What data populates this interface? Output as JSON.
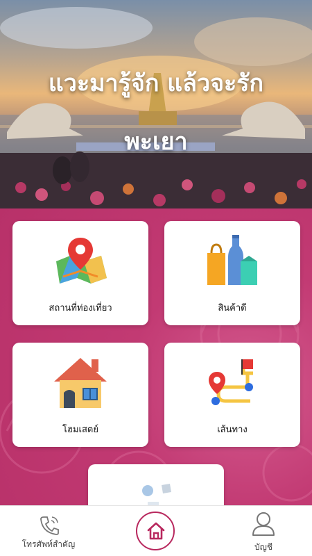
{
  "hero": {
    "title_line1": "แวะมารู้จัก แล้วจะรัก",
    "title_line2": "พะเยา"
  },
  "menu": [
    {
      "label": "สถานที่ท่องเที่ยว",
      "icon": "map-pin-icon"
    },
    {
      "label": "สินค้าดี",
      "icon": "shopping-products-icon"
    },
    {
      "label": "โฮมเสตย์",
      "icon": "house-icon"
    },
    {
      "label": "เส้นทาง",
      "icon": "route-icon"
    },
    {
      "label": "",
      "icon": "services-icon"
    }
  ],
  "bottom_nav": {
    "phone_label": "โทรศัพท์สำคัญ",
    "account_label": "บัญชี"
  },
  "colors": {
    "accent": "#b8285e",
    "background_pink": "#c23a73",
    "card": "#ffffff"
  }
}
